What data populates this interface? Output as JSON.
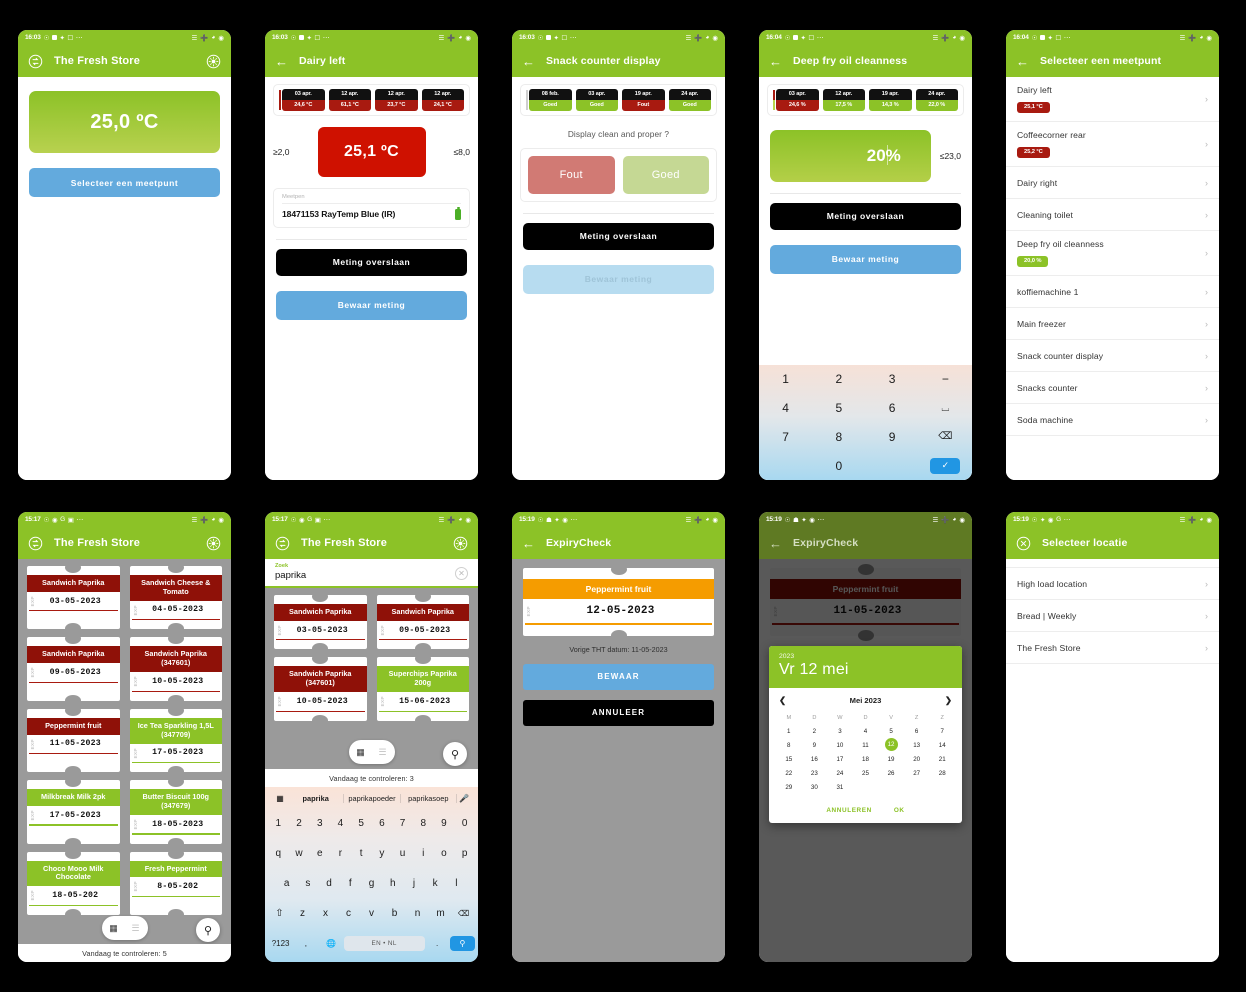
{
  "app": {
    "brand_green": "#8cc227",
    "red": "#a81a10",
    "blue": "#63aadd",
    "orange": "#f59c00"
  },
  "screens": [
    {
      "id": "home-temperature",
      "status_time": "16:03",
      "title": "The Fresh Store",
      "left_icon": "refresh-icon",
      "right_icon": "gear-icon",
      "value": "25,0 ºC",
      "primary_button": "Selecteer een meetpunt"
    },
    {
      "id": "dairy-left-measure",
      "status_time": "16:03",
      "title": "Dairy left",
      "history": [
        {
          "date": "03 apr.",
          "value": "24,6 °C",
          "state": "red"
        },
        {
          "date": "12 apr.",
          "value": "61,1 °C",
          "state": "red"
        },
        {
          "date": "12 apr.",
          "value": "23,7 °C",
          "state": "red"
        },
        {
          "date": "12 apr.",
          "value": "24,1 °C",
          "state": "red"
        }
      ],
      "limit_low": "≥2,0",
      "limit_high": "≤8,0",
      "value": "25,1 ºC",
      "probe_label": "Meetpen",
      "probe_name": "18471153 RayTemp Blue (IR)",
      "skip_button": "Meting overslaan",
      "save_button": "Bewaar meting"
    },
    {
      "id": "snack-counter-display",
      "status_time": "16:03",
      "title": "Snack counter display",
      "history": [
        {
          "date": "08 feb.",
          "value": "Goed",
          "state": "green"
        },
        {
          "date": "03 apr.",
          "value": "Goed",
          "state": "green"
        },
        {
          "date": "19 apr.",
          "value": "Fout",
          "state": "red"
        },
        {
          "date": "24 apr.",
          "value": "Goed",
          "state": "green"
        }
      ],
      "question": "Display clean and proper ?",
      "choice_bad": "Fout",
      "choice_good": "Goed",
      "skip_button": "Meting overslaan",
      "save_button": "Bewaar meting"
    },
    {
      "id": "deep-fry-oil-cleanness",
      "status_time": "16:04",
      "title": "Deep fry oil cleanness",
      "history": [
        {
          "date": "03 apr.",
          "value": "24,6 %",
          "state": "red"
        },
        {
          "date": "12 apr.",
          "value": "17,5 %",
          "state": "green"
        },
        {
          "date": "19 apr.",
          "value": "14,3 %",
          "state": "green"
        },
        {
          "date": "24 apr.",
          "value": "22,0 %",
          "state": "green"
        }
      ],
      "value": "20%",
      "limit_high": "≤23,0",
      "skip_button": "Meting overslaan",
      "save_button": "Bewaar meting",
      "numpad": [
        "1",
        "2",
        "3",
        "−",
        "4",
        "5",
        "6",
        "⌴",
        "7",
        "8",
        "9",
        "⌫",
        "*",
        "0",
        ".",
        "✓"
      ]
    },
    {
      "id": "select-measurepoint",
      "status_time": "16:04",
      "title": "Selecteer een meetpunt",
      "items": [
        {
          "label": "Dairy left",
          "badge": "25,1 °C",
          "badge_state": "red"
        },
        {
          "label": "Coffeecorner rear",
          "badge": "25,2 °C",
          "badge_state": "red"
        },
        {
          "label": "Dairy right",
          "badge": "",
          "badge_state": ""
        },
        {
          "label": "Cleaning toilet",
          "badge": "",
          "badge_state": ""
        },
        {
          "label": "Deep fry oil cleanness",
          "badge": "20,0 %",
          "badge_state": "green"
        },
        {
          "label": "koffiemachine 1",
          "badge": "",
          "badge_state": ""
        },
        {
          "label": "Main freezer",
          "badge": "",
          "badge_state": ""
        },
        {
          "label": "Snack counter display",
          "badge": "",
          "badge_state": ""
        },
        {
          "label": "Snacks counter",
          "badge": "",
          "badge_state": ""
        },
        {
          "label": "Soda machine",
          "badge": "",
          "badge_state": ""
        }
      ]
    },
    {
      "id": "expiry-ticket-grid",
      "status_time": "15:17",
      "title": "The Fresh Store",
      "left_icon": "refresh-icon",
      "right_icon": "gear-icon",
      "tickets": [
        {
          "name": "Sandwich Paprika",
          "date": "03-05-2023",
          "state": "red"
        },
        {
          "name": "Sandwich Cheese & Tomato",
          "date": "04-05-2023",
          "state": "red"
        },
        {
          "name": "Sandwich Paprika",
          "date": "09-05-2023",
          "state": "red"
        },
        {
          "name": "Sandwich Paprika (347601)",
          "date": "10-05-2023",
          "state": "red"
        },
        {
          "name": "Peppermint fruit",
          "date": "11-05-2023",
          "state": "red"
        },
        {
          "name": "Ice Tea Sparkling 1,5L (347709)",
          "date": "17-05-2023",
          "state": "green"
        },
        {
          "name": "Milkbreak Milk 2pk",
          "date": "17-05-2023",
          "state": "green"
        },
        {
          "name": "Butter Biscuit 100g (347679)",
          "date": "18-05-2023",
          "state": "green"
        },
        {
          "name": "Choco Mooo Milk Chocolate",
          "date": "18-05-202",
          "state": "green"
        },
        {
          "name": "Fresh  Peppermint",
          "date": "8-05-202",
          "state": "green"
        }
      ],
      "footer": "Vandaag te controleren: 5",
      "grid_icon": "grid-view-icon",
      "list_icon": "list-view-icon",
      "search_fab": "search-icon"
    },
    {
      "id": "expiry-search",
      "status_time": "15:17",
      "title": "The Fresh Store",
      "search_label": "Zoek",
      "search_value": "paprika",
      "tickets": [
        {
          "name": "Sandwich Paprika",
          "date": "03-05-2023",
          "state": "red"
        },
        {
          "name": "Sandwich Paprika",
          "date": "09-05-2023",
          "state": "red"
        },
        {
          "name": "Sandwich Paprika (347601)",
          "date": "10-05-2023",
          "state": "red"
        },
        {
          "name": "Superchips Paprika 200g",
          "date": "15-06-2023",
          "state": "green"
        }
      ],
      "footer": "Vandaag te controleren: 3",
      "keyboard": {
        "suggestions": [
          "paprika",
          "paprikapoeder",
          "paprikasoep"
        ],
        "row_numbers": [
          "1",
          "2",
          "3",
          "4",
          "5",
          "6",
          "7",
          "8",
          "9",
          "0"
        ],
        "row1": [
          "q",
          "w",
          "e",
          "r",
          "t",
          "y",
          "u",
          "i",
          "o",
          "p"
        ],
        "row2": [
          "a",
          "s",
          "d",
          "f",
          "g",
          "h",
          "j",
          "k",
          "l"
        ],
        "row3": [
          "⇧",
          "z",
          "x",
          "c",
          "v",
          "b",
          "n",
          "m",
          "⌫"
        ],
        "sym_key": "?123",
        "comma_key": ",",
        "globe_key": "globe-icon",
        "space_label": "EN • NL",
        "period_key": ".",
        "enter_key": "search-icon"
      }
    },
    {
      "id": "expirycheck-edit",
      "status_time": "15:19",
      "title": "ExpiryCheck",
      "ticket": {
        "name": "Peppermint fruit",
        "date": "12-05-2023",
        "state": "orange"
      },
      "previous_label": "Vorige THT datum: 11-05-2023",
      "save_button": "BEWAAR",
      "cancel_button": "ANNULEER"
    },
    {
      "id": "expirycheck-datepicker",
      "status_time": "15:19",
      "title": "ExpiryCheck",
      "ticket": {
        "name": "Peppermint fruit",
        "date": "11-05-2023",
        "state": "red"
      },
      "dialog": {
        "year": "2023",
        "headline": "Vr 12 mei",
        "month_label": "Mei 2023",
        "prev_icon": "chevron-left-icon",
        "next_icon": "chevron-right-icon",
        "dow": [
          "M",
          "D",
          "W",
          "D",
          "V",
          "Z",
          "Z"
        ],
        "lead_blanks": 0,
        "days": [
          1,
          2,
          3,
          4,
          5,
          6,
          7,
          8,
          9,
          10,
          11,
          12,
          13,
          14,
          15,
          16,
          17,
          18,
          19,
          20,
          21,
          22,
          23,
          24,
          25,
          26,
          27,
          28,
          29,
          30,
          31
        ],
        "selected_day": 12,
        "cancel": "ANNULEREN",
        "ok": "OK"
      }
    },
    {
      "id": "select-location",
      "status_time": "15:19",
      "title": "Selecteer locatie",
      "left_icon": "close-icon",
      "items": [
        {
          "label": "High load location"
        },
        {
          "label": "Bread | Weekly"
        },
        {
          "label": "The Fresh Store"
        }
      ]
    }
  ]
}
